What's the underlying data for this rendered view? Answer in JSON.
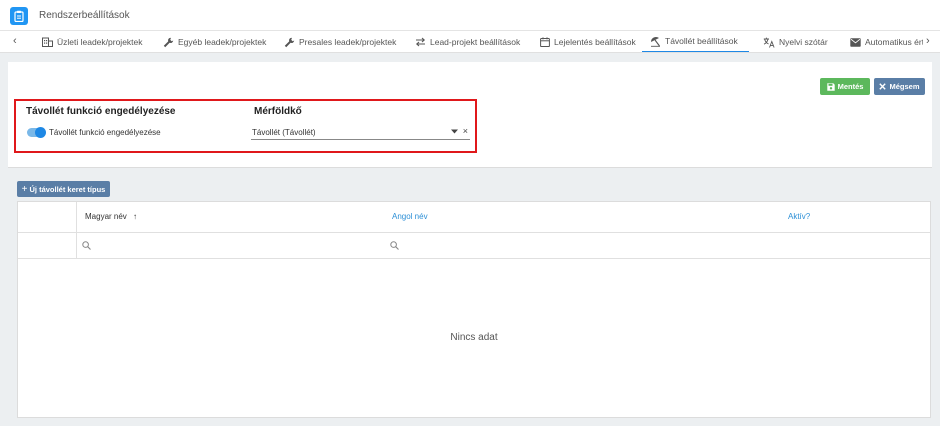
{
  "app": {
    "title": "Rendszerbeállítások",
    "icon": "clipboard-icon"
  },
  "tabs": [
    {
      "label": "Üzleti leadek/projektek",
      "icon": "building-icon"
    },
    {
      "label": "Egyéb leadek/projektek",
      "icon": "wrench-icon"
    },
    {
      "label": "Presales leadek/projektek",
      "icon": "wrench-icon"
    },
    {
      "label": "Lead-projekt beállítások",
      "icon": "swap-icon"
    },
    {
      "label": "Lejelentés beállítások",
      "icon": "calendar-icon"
    },
    {
      "label": "Távollét beállítások",
      "icon": "beach-icon",
      "active": true
    },
    {
      "label": "Nyelvi szótár",
      "icon": "translate-icon"
    },
    {
      "label": "Automatikus ért",
      "icon": "mail-icon"
    }
  ],
  "nav": {
    "prev": "‹",
    "next": "›"
  },
  "toolbar": {
    "save_label": "Mentés",
    "cancel_label": "Mégsem",
    "save_color": "#5cb85c",
    "cancel_color": "#5a7ea6"
  },
  "settings": {
    "feature_title": "Távollét funkció engedélyezése",
    "toggle_label": "Távollét funkció engedélyezése",
    "toggle_on": true,
    "milestone_title": "Mérföldkő",
    "milestone_value": "Távollét (Távollét)"
  },
  "grid": {
    "new_button_label": "Új távollét keret típus",
    "columns": [
      {
        "label": "Magyar név",
        "sort": "↑"
      },
      {
        "label": "Angol név"
      },
      {
        "label": "Aktív?"
      }
    ],
    "empty_text": "Nincs adat"
  }
}
